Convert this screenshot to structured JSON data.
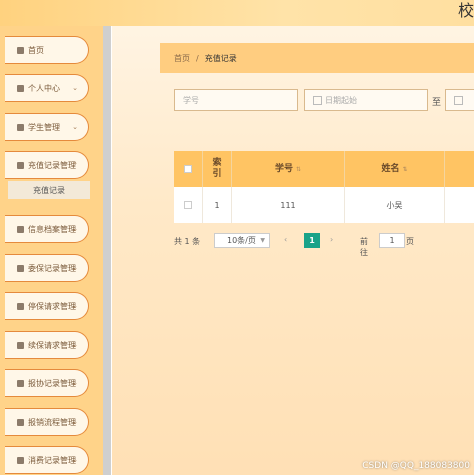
{
  "header": {
    "title": "校"
  },
  "sidebar": {
    "items": [
      {
        "label": "首页",
        "has_arrow": false
      },
      {
        "label": "个人中心",
        "has_arrow": true
      },
      {
        "label": "学生管理",
        "has_arrow": true
      },
      {
        "label": "充值记录管理",
        "has_arrow": true
      },
      {
        "label": "信息档案管理",
        "has_arrow": true
      },
      {
        "label": "委保记录管理",
        "has_arrow": true
      },
      {
        "label": "停保请求管理",
        "has_arrow": true
      },
      {
        "label": "续保请求管理",
        "has_arrow": true
      },
      {
        "label": "报协记录管理",
        "has_arrow": true
      },
      {
        "label": "报销流程管理",
        "has_arrow": true
      },
      {
        "label": "消费记录管理",
        "has_arrow": true
      }
    ],
    "active_sub": "充值记录"
  },
  "breadcrumb": {
    "home": "首页",
    "separator": "/",
    "current": "充值记录"
  },
  "search": {
    "student_no_placeholder": "学号",
    "date_start_placeholder": "日期起始",
    "range_to": "至"
  },
  "table": {
    "columns": [
      "索\n引",
      "学号",
      "姓名"
    ],
    "rows": [
      {
        "index": "1",
        "student_no": "111",
        "name": "小吴"
      }
    ]
  },
  "pagination": {
    "total": "共 1 条",
    "page_size": "10条/页",
    "current_page": "1",
    "goto_label": "前往",
    "goto_value": "1",
    "goto_unit": "页"
  },
  "watermark": "CSDN @QQ_188083800",
  "colors": {
    "accent": "#ffc463",
    "sidebar": "#ffd389",
    "pager_active": "#1aa389"
  }
}
